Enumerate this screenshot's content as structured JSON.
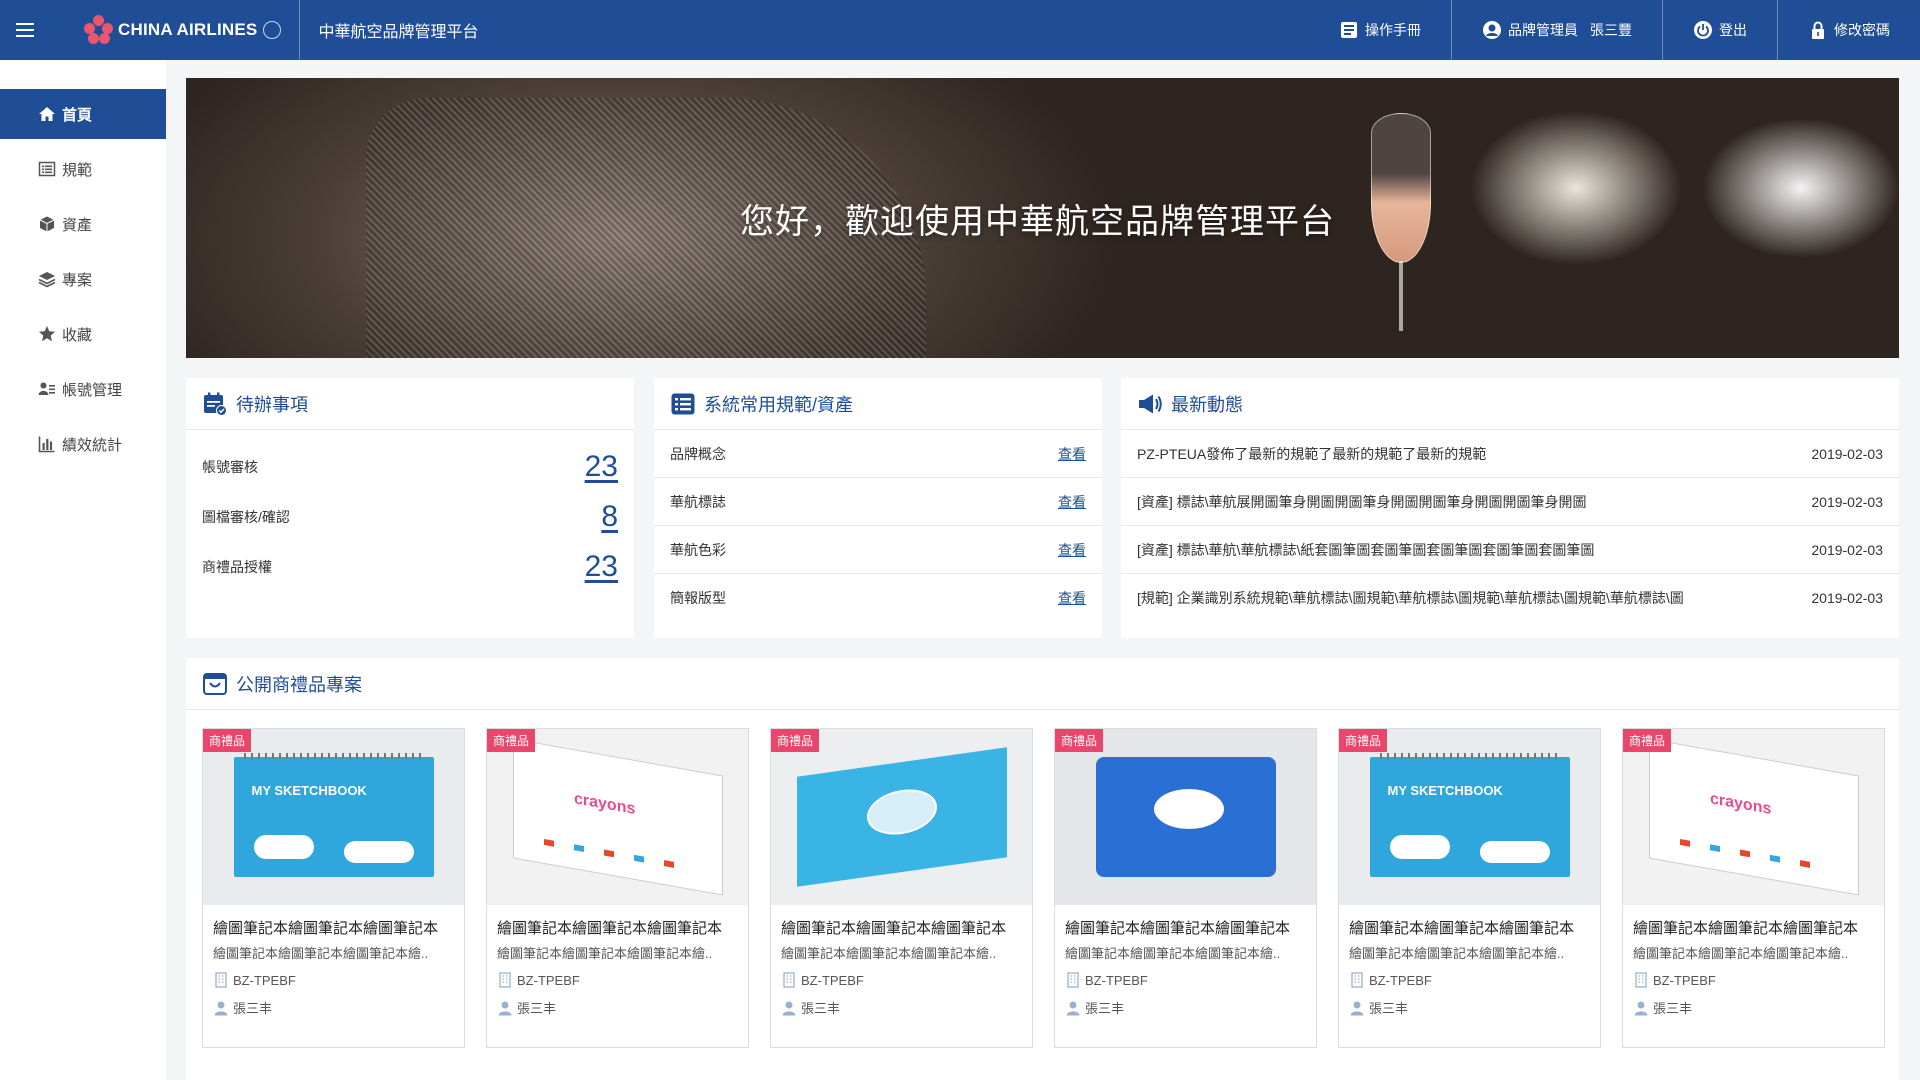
{
  "topbar": {
    "logo_text": "CHINA AIRLINES",
    "platform_title": "中華航空品牌管理平台",
    "manual": "操作手冊",
    "user_role": "品牌管理員",
    "user_name": "張三豐",
    "logout": "登出",
    "change_password": "修改密碼",
    "bg_color": "#1f4d96"
  },
  "sidebar": {
    "items": [
      {
        "label": "首頁",
        "icon": "home-icon",
        "active": true
      },
      {
        "label": "規範",
        "icon": "list-icon"
      },
      {
        "label": "資產",
        "icon": "cube-icon"
      },
      {
        "label": "專案",
        "icon": "layers-icon"
      },
      {
        "label": "收藏",
        "icon": "star-icon"
      },
      {
        "label": "帳號管理",
        "icon": "user-list-icon"
      },
      {
        "label": "績效統計",
        "icon": "bar-chart-icon"
      }
    ]
  },
  "hero": {
    "text": "您好，歡迎使用中華航空品牌管理平台"
  },
  "todo": {
    "title": "待辦事項",
    "rows": [
      {
        "label": "帳號審核",
        "count": "23"
      },
      {
        "label": "圖檔審核/確認",
        "count": "8"
      },
      {
        "label": "商禮品授權",
        "count": "23"
      }
    ]
  },
  "spec": {
    "title": "系統常用規範/資產",
    "rows": [
      {
        "label": "品牌概念",
        "link": "查看"
      },
      {
        "label": "華航標誌",
        "link": "查看"
      },
      {
        "label": "華航色彩",
        "link": "查看"
      },
      {
        "label": "簡報版型",
        "link": "查看"
      }
    ]
  },
  "news": {
    "title": "最新動態",
    "rows": [
      {
        "text": "PZ-PTEUA發佈了最新的規範了最新的規範了最新的規範",
        "date": "2019-02-03"
      },
      {
        "text": "[資產] 標誌\\華航展開圖筆身開圖開圖筆身開圖開圖筆身開圖開圖筆身開圖",
        "date": "2019-02-03"
      },
      {
        "text": "[資產] 標誌\\華航\\華航標誌\\紙套圖筆圖套圖筆圖套圖筆圖套圖筆圖套圖筆圖",
        "date": "2019-02-03"
      },
      {
        "text": "[規範] 企業識別系統規範\\華航標誌\\圖規範\\華航標誌\\圖規範\\華航標誌\\圖規範\\華航標誌\\圖",
        "date": "2019-02-03"
      }
    ]
  },
  "gifts": {
    "title": "公開商禮品專案",
    "items": [
      {
        "tag": "商禮品",
        "product": "sketchbook",
        "title": "繪圖筆記本繪圖筆記本繪圖筆記本",
        "subtitle": "繪圖筆記本繪圖筆記本繪圖筆記本繪..",
        "code": "BZ-TPEBF",
        "owner": "張三丰"
      },
      {
        "tag": "商禮品",
        "product": "crayons",
        "title": "繪圖筆記本繪圖筆記本繪圖筆記本",
        "subtitle": "繪圖筆記本繪圖筆記本繪圖筆記本繪..",
        "code": "BZ-TPEBF",
        "owner": "張三丰"
      },
      {
        "tag": "商禮品",
        "product": "tissue-box",
        "title": "繪圖筆記本繪圖筆記本繪圖筆記本",
        "subtitle": "繪圖筆記本繪圖筆記本繪圖筆記本繪..",
        "code": "BZ-TPEBF",
        "owner": "張三丰"
      },
      {
        "tag": "商禮品",
        "product": "pouch",
        "title": "繪圖筆記本繪圖筆記本繪圖筆記本",
        "subtitle": "繪圖筆記本繪圖筆記本繪圖筆記本繪..",
        "code": "BZ-TPEBF",
        "owner": "張三丰"
      },
      {
        "tag": "商禮品",
        "product": "sketchbook",
        "title": "繪圖筆記本繪圖筆記本繪圖筆記本",
        "subtitle": "繪圖筆記本繪圖筆記本繪圖筆記本繪..",
        "code": "BZ-TPEBF",
        "owner": "張三丰"
      },
      {
        "tag": "商禮品",
        "product": "crayons",
        "title": "繪圖筆記本繪圖筆記本繪圖筆記本",
        "subtitle": "繪圖筆記本繪圖筆記本繪圖筆記本繪..",
        "code": "BZ-TPEBF",
        "owner": "張三丰"
      }
    ],
    "sketchbook_word": "MY SKETCHBOOK",
    "crayon_word": "crayons"
  }
}
